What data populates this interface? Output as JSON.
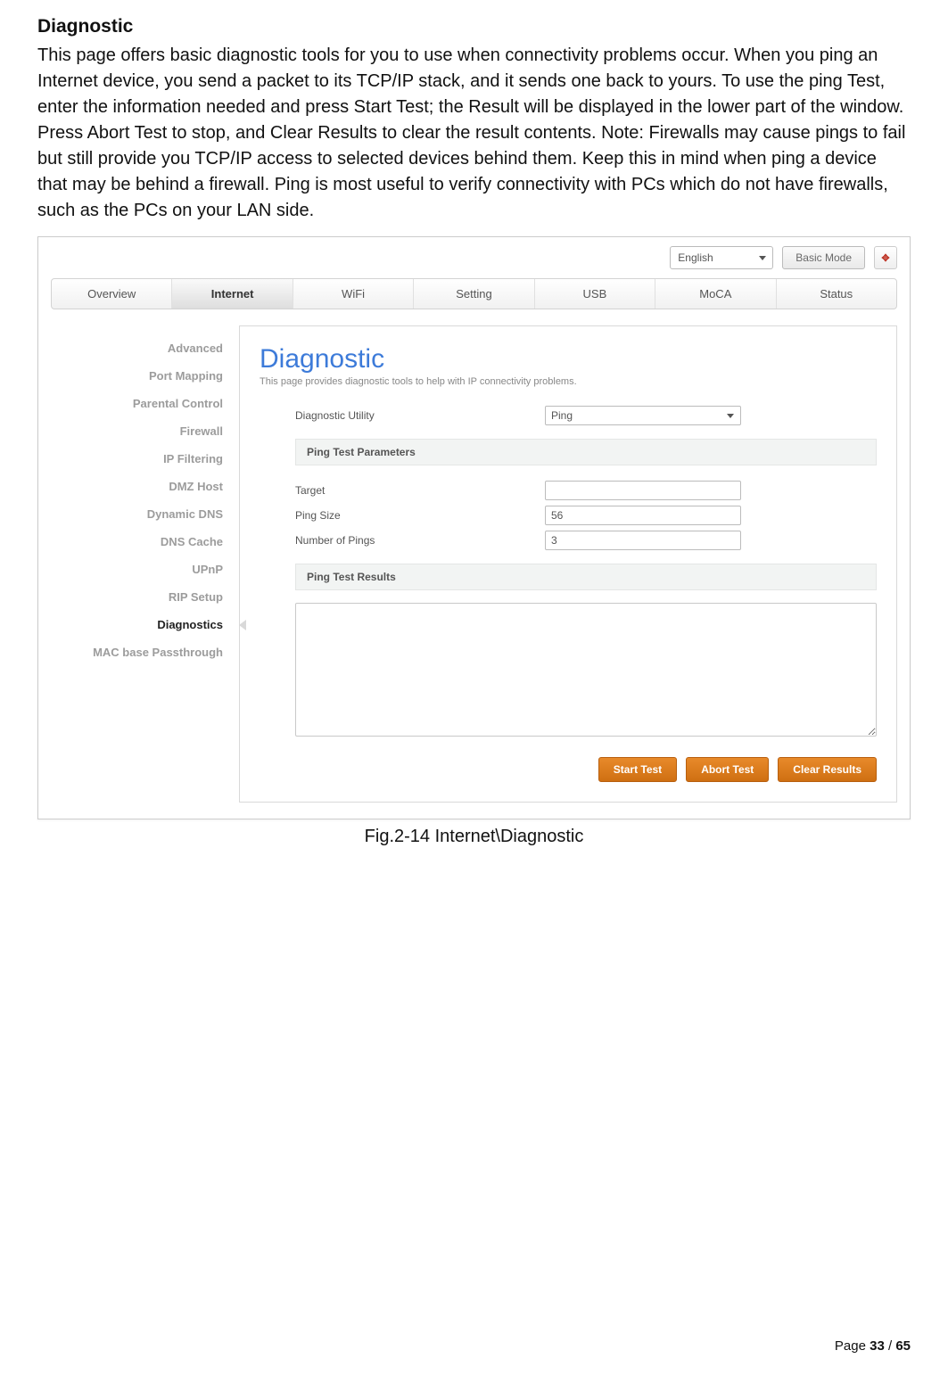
{
  "doc": {
    "title": "Diagnostic",
    "body": "This page offers basic diagnostic tools for you to use when connectivity problems occur. When you ping an Internet device, you send a packet to its TCP/IP stack, and it sends one back to yours. To use the ping Test, enter the information needed and press Start Test; the Result will be displayed in the lower part of the window. Press Abort Test to stop, and Clear Results to clear the result contents. Note: Firewalls may cause pings to fail but still provide you TCP/IP access to selected devices behind them. Keep this in mind when ping a device that may be behind a firewall. Ping is most useful to verify connectivity with PCs which do not have firewalls, such as the PCs on your LAN side.",
    "caption": "Fig.2-14 Internet\\Diagnostic",
    "page_prefix": "Page ",
    "page_current": "33",
    "page_sep": " / ",
    "page_total": "65"
  },
  "topbar": {
    "language": "English",
    "mode_btn": "Basic Mode",
    "cube_icon_text": "✥"
  },
  "tabs": [
    "Overview",
    "Internet",
    "WiFi",
    "Setting",
    "USB",
    "MoCA",
    "Status"
  ],
  "tabs_active_index": 1,
  "sidebar": [
    "Advanced",
    "Port Mapping",
    "Parental Control",
    "Firewall",
    "IP Filtering",
    "DMZ Host",
    "Dynamic DNS",
    "DNS Cache",
    "UPnP",
    "RIP Setup",
    "Diagnostics",
    "MAC base Passthrough"
  ],
  "sidebar_active_index": 10,
  "panel": {
    "title": "Diagnostic",
    "subtitle": "This page provides diagnostic tools to help with IP connectivity problems.",
    "utility_label": "Diagnostic Utility",
    "utility_value": "Ping",
    "section_params": "Ping Test Parameters",
    "target_label": "Target",
    "target_value": "",
    "size_label": "Ping Size",
    "size_value": "56",
    "count_label": "Number of Pings",
    "count_value": "3",
    "section_results": "Ping Test Results",
    "results_value": "",
    "btn_start": "Start Test",
    "btn_abort": "Abort Test",
    "btn_clear": "Clear Results"
  }
}
